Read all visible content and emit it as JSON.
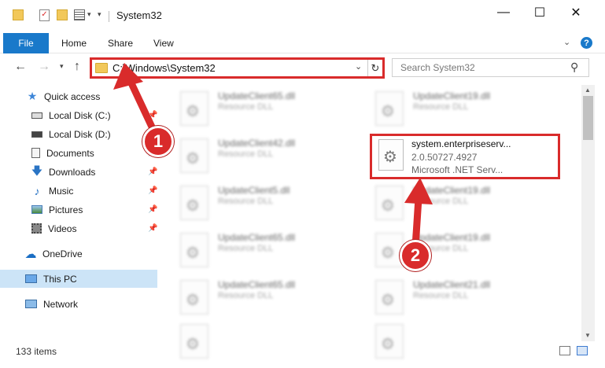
{
  "window": {
    "title": "System32"
  },
  "ribbon": {
    "tabs": [
      "File",
      "Home",
      "Share",
      "View"
    ],
    "help": "?"
  },
  "nav": {
    "address": "C:\\Windows\\System32",
    "search_placeholder": "Search System32"
  },
  "sidebar": {
    "items": [
      {
        "label": "Quick access",
        "icon": "star-icon"
      },
      {
        "label": "Local Disk (C:)",
        "icon": "drive-icon"
      },
      {
        "label": "Local Disk (D:)",
        "icon": "drive-icon"
      },
      {
        "label": "Documents",
        "icon": "documents-icon"
      },
      {
        "label": "Downloads",
        "icon": "download-icon"
      },
      {
        "label": "Music",
        "icon": "music-icon"
      },
      {
        "label": "Pictures",
        "icon": "pictures-icon"
      },
      {
        "label": "Videos",
        "icon": "videos-icon"
      },
      {
        "label": "OneDrive",
        "icon": "cloud-icon"
      },
      {
        "label": "This PC",
        "icon": "computer-icon"
      },
      {
        "label": "Network",
        "icon": "network-icon"
      }
    ]
  },
  "files": [
    {
      "name": "UpdateClient65.dll",
      "desc": "Resource DLL"
    },
    {
      "name": "UpdateClient19.dll",
      "desc": "Resource DLL"
    },
    {
      "name": "UpdateClient42.dll",
      "desc": "Resource DLL"
    },
    {
      "name": "UpdateClient5.dll",
      "desc": "Resource DLL"
    },
    {
      "name": "UpdateClient19.dll",
      "desc": "Resource DLL"
    },
    {
      "name": "UpdateClient65.dll",
      "desc": "Resource DLL"
    },
    {
      "name": "UpdateClient19.dll",
      "desc": "Resource DLL"
    },
    {
      "name": "UpdateClient65.dll",
      "desc": "Resource DLL"
    },
    {
      "name": "UpdateClient21.dll",
      "desc": "Resource DLL"
    },
    {
      "name": "",
      "desc": ""
    },
    {
      "name": "",
      "desc": ""
    }
  ],
  "highlighted_file": {
    "name": "system.enterpriseserv...",
    "version": "2.0.50727.4927",
    "company": "Microsoft .NET Serv..."
  },
  "status": {
    "items": "133 items"
  },
  "annotations": {
    "step1": "1",
    "step2": "2"
  },
  "colors": {
    "accent": "#1979ca",
    "annotation": "#d92b2b",
    "selected": "#cce4f7"
  }
}
